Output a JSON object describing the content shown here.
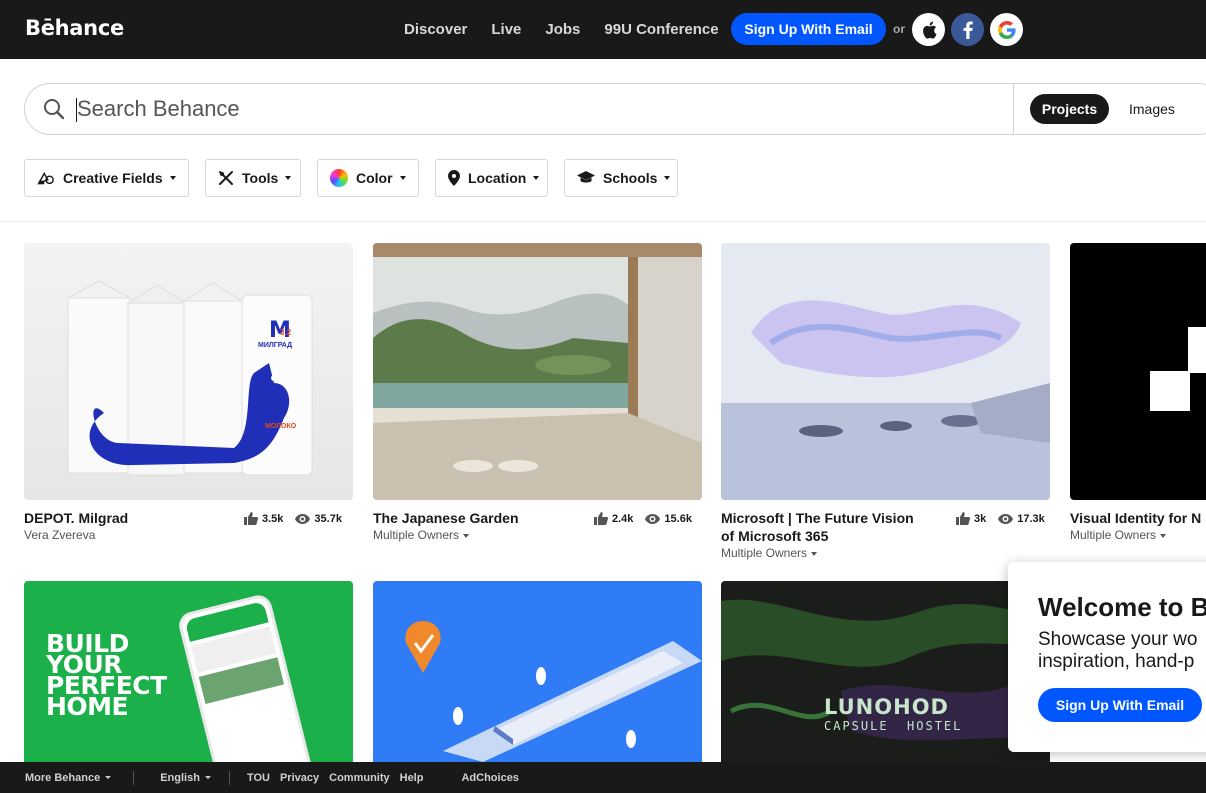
{
  "header": {
    "logo": "Bēhance",
    "nav": [
      "Discover",
      "Live",
      "Jobs",
      "99U Conference"
    ],
    "signup_label": "Sign Up With Email",
    "or_label": "or"
  },
  "search": {
    "placeholder": "Search Behance",
    "value": "",
    "segments": {
      "projects": "Projects",
      "images": "Images"
    }
  },
  "filters": {
    "creative_fields": "Creative Fields",
    "tools": "Tools",
    "color": "Color",
    "location": "Location",
    "schools": "Schools"
  },
  "projects": [
    {
      "title": "DEPOT. Milgrad",
      "owner": "Vera Zvereva",
      "likes": "3.5k",
      "views": "35.7k",
      "thumb_text": [
        "M",
        "МИЛГРАД",
        "МОЛОКО",
        "3.2"
      ]
    },
    {
      "title": "The Japanese Garden",
      "owner": "Multiple Owners",
      "likes": "2.4k",
      "views": "15.6k"
    },
    {
      "title": "Microsoft | The Future Vision",
      "title2": "of Microsoft 365",
      "owner": "Multiple Owners",
      "likes": "3k",
      "views": "17.3k"
    },
    {
      "title": "Visual Identity for N",
      "owner": "Multiple Owners"
    },
    {
      "title": "",
      "thumb_text": [
        "BUILD",
        "YOUR",
        "PERFECT",
        "HOME"
      ]
    },
    {
      "title": ""
    },
    {
      "title": "",
      "thumb_text": [
        "LUNOHOD",
        "CAPSULE  HOSTEL"
      ]
    }
  ],
  "welcome": {
    "heading": "Welcome to B",
    "line1": "Showcase your wo",
    "line2": "inspiration, hand-p",
    "button": "Sign Up With Email"
  },
  "footer": {
    "more": "More Behance",
    "language": "English",
    "links": [
      "TOU",
      "Privacy",
      "Community",
      "Help"
    ],
    "adchoices": "AdChoices"
  },
  "colors": {
    "brand_blue": "#0057ff",
    "dark": "#191919"
  }
}
